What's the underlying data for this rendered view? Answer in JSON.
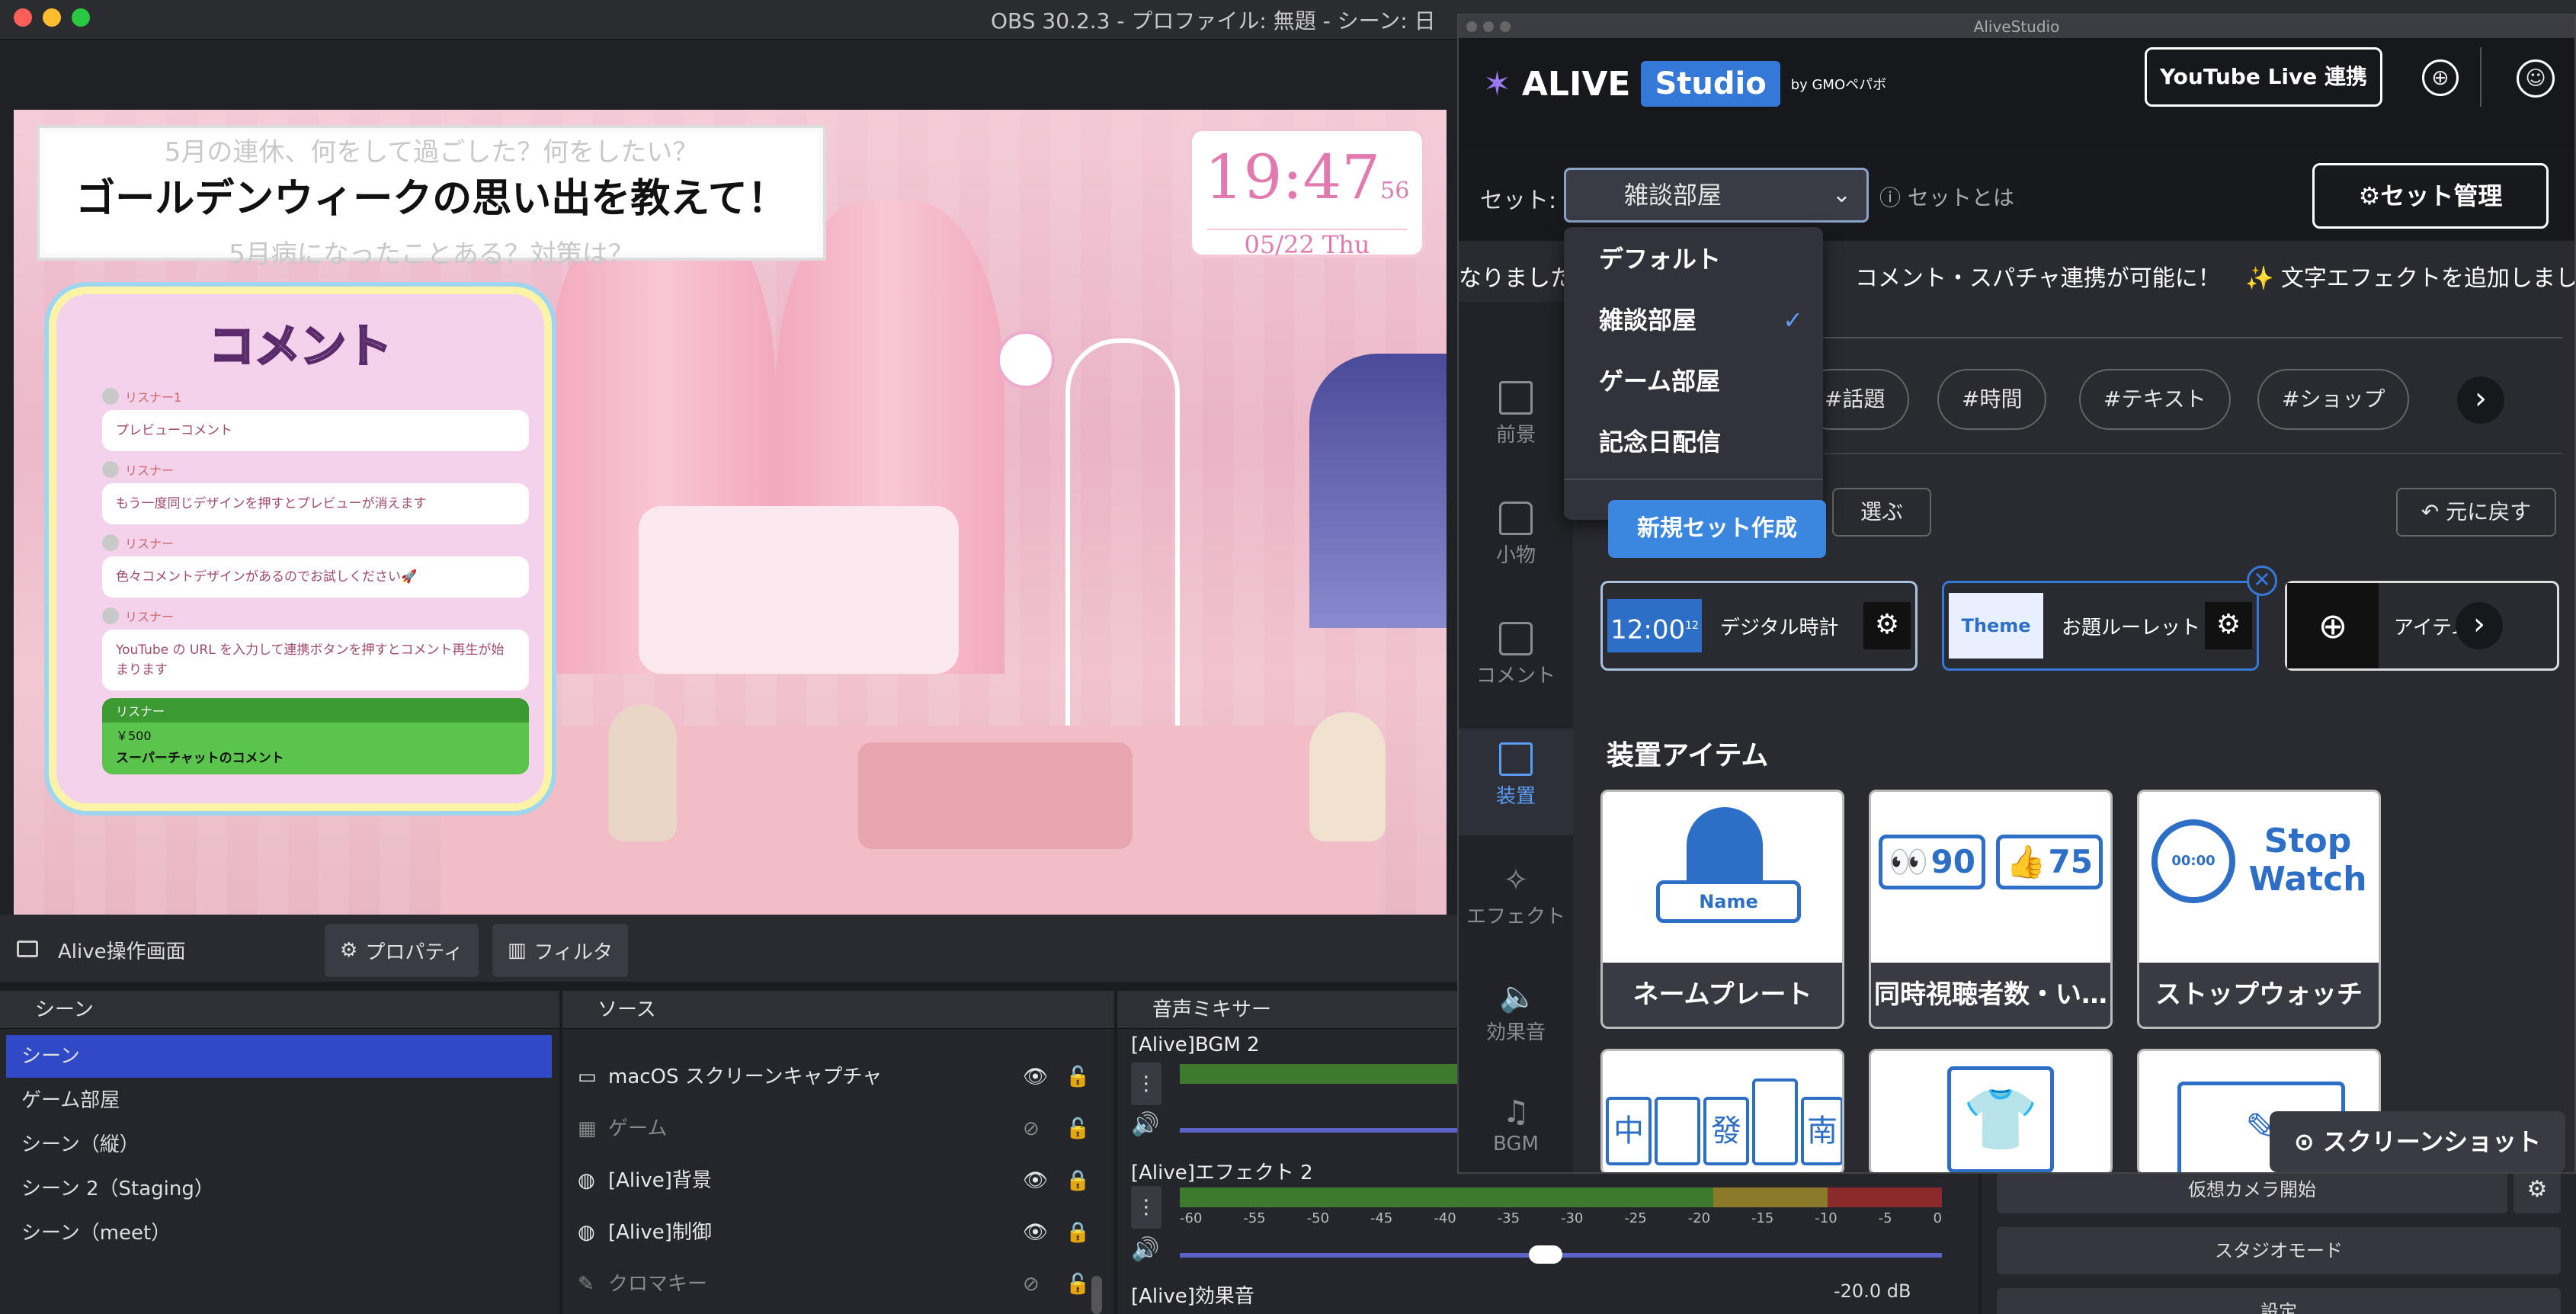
{
  "obs": {
    "window_title": "OBS 30.2.3 - プロファイル: 無題 - シーン: 日"
  },
  "overlay": {
    "question_sub_top": "5月の連休、何をして過ごした？何をしたい？",
    "question_main": "ゴールデンウィークの思い出を教えて！",
    "question_sub_bottom": "5月病になったことある？対策は？",
    "clock_time": "19:47",
    "clock_sec": "56",
    "clock_date": "05/22 Thu",
    "comments_title": "コメント",
    "comments": [
      {
        "name": "リスナー1",
        "text": "プレビューコメント"
      },
      {
        "name": "リスナー",
        "text": "もう一度同じデザインを押すとプレビューが消えます"
      },
      {
        "name": "リスナー",
        "text": "色々コメントデザインがあるのでお試しください🚀"
      },
      {
        "name": "リスナー",
        "text": "YouTube の URL を入力して連携ボタンを押すとコメント再生が始まります"
      }
    ],
    "superchat": {
      "name": "リスナー",
      "amount": "￥500",
      "text": "スーパーチャットのコメント"
    }
  },
  "toolbar": {
    "source_name": "Alive操作画面",
    "properties_label": "プロパティ",
    "filters_label": "フィルタ"
  },
  "scenes": {
    "title": "シーン",
    "items": [
      "シーン",
      "ゲーム部屋",
      "シーン（縦）",
      "シーン 2（Staging）",
      "シーン（meet）"
    ],
    "selected": 0
  },
  "sources": {
    "title": "ソース",
    "items": [
      {
        "name": "macOS スクリーンキャプチャ",
        "visible": true,
        "locked": false
      },
      {
        "name": "ゲーム",
        "visible": false,
        "locked": false
      },
      {
        "name": "[Alive]背景",
        "visible": true,
        "locked": true
      },
      {
        "name": "[Alive]制御",
        "visible": true,
        "locked": true
      },
      {
        "name": "クロマキー",
        "visible": false,
        "locked": false
      }
    ]
  },
  "mixer": {
    "title": "音声ミキサー",
    "channels": [
      {
        "name": "[Alive]BGM 2",
        "level": 0.3
      },
      {
        "name": "[Alive]エフェクト 2",
        "level": 0.3
      },
      {
        "name": "[Alive]効果音",
        "level": 0.3,
        "db": "-20.0 dB"
      }
    ],
    "ticks": [
      "-60",
      "-55",
      "-50",
      "-45",
      "-40",
      "-35",
      "-30",
      "-25",
      "-20",
      "-15",
      "-10",
      "-5",
      "0"
    ]
  },
  "controls": {
    "virtual_camera": "仮想カメラ開始",
    "studio_mode": "スタジオモード",
    "settings": "設定"
  },
  "alive": {
    "window_title": "AliveStudio",
    "logo_text": "ALIVE",
    "studio_badge": "Studio",
    "by_text": "by GMOペパボ",
    "youtube_button": "YouTube Live 連携",
    "set_label": "セット:",
    "set_selected": "雑談部屋",
    "set_help": "セットとは",
    "set_manage": "セット管理",
    "dropdown": {
      "items": [
        "デフォルト",
        "雑談部屋",
        "ゲーム部屋",
        "記念日配信"
      ],
      "selected_index": 1,
      "new_set_button": "新規セット作成"
    },
    "marquee": [
      "なりました",
      "コメント・スパチャ連携が可能に！",
      "✨ 文字エフェクトを追加しました"
    ],
    "sidebar": [
      {
        "label": "前景",
        "icon": "foreground-icon"
      },
      {
        "label": "小物",
        "icon": "accessory-icon"
      },
      {
        "label": "コメント",
        "icon": "comment-icon"
      },
      {
        "label": "装置",
        "icon": "device-icon",
        "active": true
      },
      {
        "label": "エフェクト",
        "icon": "effect-icon"
      },
      {
        "label": "効果音",
        "icon": "sound-effect-icon"
      },
      {
        "label": "BGM",
        "icon": "music-icon"
      }
    ],
    "tags": [
      "#話題",
      "#時間",
      "#テキスト",
      "#ショップ"
    ],
    "choose_partial": "選ぶ",
    "reset_button": "元に戻す",
    "placed_items": [
      {
        "label": "デジタル時計",
        "thumb": "12:00",
        "thumb_sup": "12"
      },
      {
        "label": "お題ルーレット",
        "thumb": "Theme"
      },
      {
        "label": "アイテム配"
      }
    ],
    "section_title": "装置アイテム",
    "device_items": [
      {
        "label": "ネームプレート",
        "art": "Name"
      },
      {
        "label": "同時視聴者数・い…",
        "art_a": "90",
        "art_b": "75"
      },
      {
        "label": "ストップウォッチ",
        "art": "Stop Watch",
        "art_time": "00:00"
      }
    ],
    "mahjong": [
      "中",
      "發",
      "南"
    ],
    "screenshot_button": "スクリーンショット"
  },
  "colors": {
    "accent": "#3478d8",
    "selected_scene": "#2f49c7",
    "superchat": "#5bc44c"
  }
}
